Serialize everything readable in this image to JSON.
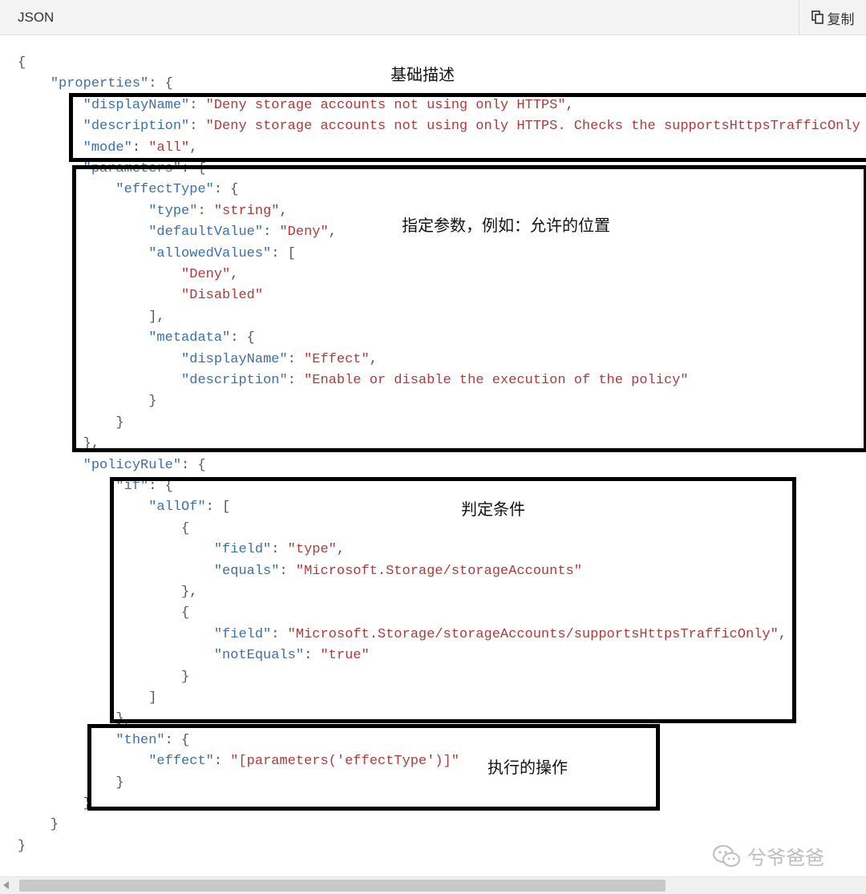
{
  "header": {
    "language": "JSON",
    "copy_label": "复制"
  },
  "code_lines": [
    [
      [
        "p",
        "{"
      ]
    ],
    [
      [
        "p",
        "    "
      ],
      [
        "k",
        "\"properties\""
      ],
      [
        "p",
        ": {"
      ]
    ],
    [
      [
        "p",
        "        "
      ],
      [
        "k",
        "\"displayName\""
      ],
      [
        "p",
        ": "
      ],
      [
        "s",
        "\"Deny storage accounts not using only HTTPS\""
      ],
      [
        "p",
        ","
      ]
    ],
    [
      [
        "p",
        "        "
      ],
      [
        "k",
        "\"description\""
      ],
      [
        "p",
        ": "
      ],
      [
        "s",
        "\"Deny storage accounts not using only HTTPS. Checks the supportsHttpsTrafficOnly prope"
      ]
    ],
    [
      [
        "p",
        "        "
      ],
      [
        "k",
        "\"mode\""
      ],
      [
        "p",
        ": "
      ],
      [
        "s",
        "\"all\""
      ],
      [
        "p",
        ","
      ]
    ],
    [
      [
        "p",
        "        "
      ],
      [
        "k",
        "\"parameters\""
      ],
      [
        "p",
        ": {"
      ]
    ],
    [
      [
        "p",
        "            "
      ],
      [
        "k",
        "\"effectType\""
      ],
      [
        "p",
        ": {"
      ]
    ],
    [
      [
        "p",
        "                "
      ],
      [
        "k",
        "\"type\""
      ],
      [
        "p",
        ": "
      ],
      [
        "s",
        "\"string\""
      ],
      [
        "p",
        ","
      ]
    ],
    [
      [
        "p",
        "                "
      ],
      [
        "k",
        "\"defaultValue\""
      ],
      [
        "p",
        ": "
      ],
      [
        "s",
        "\"Deny\""
      ],
      [
        "p",
        ","
      ]
    ],
    [
      [
        "p",
        "                "
      ],
      [
        "k",
        "\"allowedValues\""
      ],
      [
        "p",
        ": ["
      ]
    ],
    [
      [
        "p",
        "                    "
      ],
      [
        "s",
        "\"Deny\""
      ],
      [
        "p",
        ","
      ]
    ],
    [
      [
        "p",
        "                    "
      ],
      [
        "s",
        "\"Disabled\""
      ]
    ],
    [
      [
        "p",
        "                ],"
      ]
    ],
    [
      [
        "p",
        "                "
      ],
      [
        "k",
        "\"metadata\""
      ],
      [
        "p",
        ": {"
      ]
    ],
    [
      [
        "p",
        "                    "
      ],
      [
        "k",
        "\"displayName\""
      ],
      [
        "p",
        ": "
      ],
      [
        "s",
        "\"Effect\""
      ],
      [
        "p",
        ","
      ]
    ],
    [
      [
        "p",
        "                    "
      ],
      [
        "k",
        "\"description\""
      ],
      [
        "p",
        ": "
      ],
      [
        "s",
        "\"Enable or disable the execution of the policy\""
      ]
    ],
    [
      [
        "p",
        "                }"
      ]
    ],
    [
      [
        "p",
        "            }"
      ]
    ],
    [
      [
        "p",
        "        },"
      ]
    ],
    [
      [
        "p",
        "        "
      ],
      [
        "k",
        "\"policyRule\""
      ],
      [
        "p",
        ": {"
      ]
    ],
    [
      [
        "p",
        "            "
      ],
      [
        "k",
        "\"if\""
      ],
      [
        "p",
        ": {"
      ]
    ],
    [
      [
        "p",
        "                "
      ],
      [
        "k",
        "\"allOf\""
      ],
      [
        "p",
        ": ["
      ]
    ],
    [
      [
        "p",
        "                    {"
      ]
    ],
    [
      [
        "p",
        "                        "
      ],
      [
        "k",
        "\"field\""
      ],
      [
        "p",
        ": "
      ],
      [
        "s",
        "\"type\""
      ],
      [
        "p",
        ","
      ]
    ],
    [
      [
        "p",
        "                        "
      ],
      [
        "k",
        "\"equals\""
      ],
      [
        "p",
        ": "
      ],
      [
        "s",
        "\"Microsoft.Storage/storageAccounts\""
      ]
    ],
    [
      [
        "p",
        "                    },"
      ]
    ],
    [
      [
        "p",
        "                    {"
      ]
    ],
    [
      [
        "p",
        "                        "
      ],
      [
        "k",
        "\"field\""
      ],
      [
        "p",
        ": "
      ],
      [
        "s",
        "\"Microsoft.Storage/storageAccounts/supportsHttpsTrafficOnly\""
      ],
      [
        "p",
        ","
      ]
    ],
    [
      [
        "p",
        "                        "
      ],
      [
        "k",
        "\"notEquals\""
      ],
      [
        "p",
        ": "
      ],
      [
        "s",
        "\"true\""
      ]
    ],
    [
      [
        "p",
        "                    }"
      ]
    ],
    [
      [
        "p",
        "                ]"
      ]
    ],
    [
      [
        "p",
        "            },"
      ]
    ],
    [
      [
        "p",
        "            "
      ],
      [
        "k",
        "\"then\""
      ],
      [
        "p",
        ": {"
      ]
    ],
    [
      [
        "p",
        "                "
      ],
      [
        "k",
        "\"effect\""
      ],
      [
        "p",
        ": "
      ],
      [
        "s",
        "\"[parameters('effectType')]\""
      ]
    ],
    [
      [
        "p",
        "            }"
      ]
    ],
    [
      [
        "p",
        "        }"
      ]
    ],
    [
      [
        "p",
        "    }"
      ]
    ],
    [
      [
        "p",
        "}"
      ]
    ]
  ],
  "annotations": {
    "basic": "基础描述",
    "params": "指定参数，例如：允许的位置",
    "condition": "判定条件",
    "action": "执行的操作"
  },
  "watermark": {
    "text": "兮爷爸爸"
  }
}
